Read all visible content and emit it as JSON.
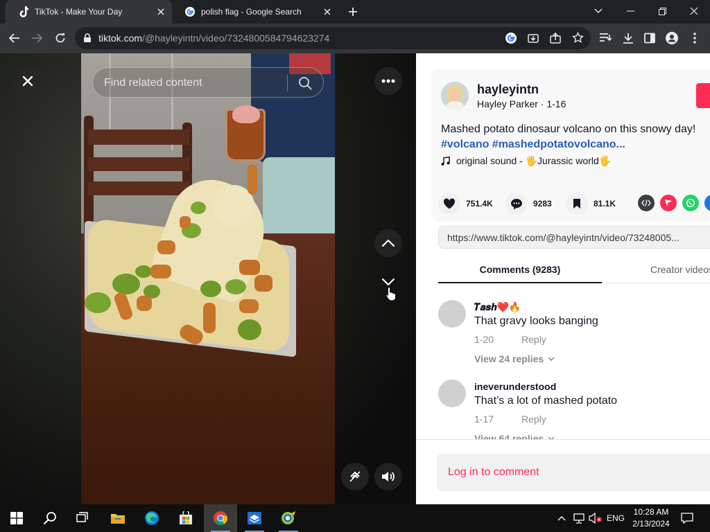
{
  "browser": {
    "tabs": [
      {
        "title": "TikTok - Make Your Day",
        "active": true,
        "favicon": "tiktok-icon"
      },
      {
        "title": "polish flag - Google Search",
        "active": false,
        "favicon": "google-icon"
      }
    ],
    "url": {
      "host": "tiktok.com",
      "path": "/@hayleyintn/video/7324800584794623274"
    }
  },
  "video": {
    "search_placeholder": "Find related content"
  },
  "post": {
    "author_id": "hayleyintn",
    "author_name": "Hayley Parker",
    "date": "1-16",
    "author_sub": "Hayley Parker · 1-16",
    "description": "Mashed potato dinosaur volcano on this snowy day!",
    "hashtags": "#volcano #mashedpotatovolcano...",
    "sound": "original sound - 🖐️Jurassic world🖐️",
    "likes": "751.4K",
    "comments_count": "9283",
    "saves": "81.1K",
    "link": "https://www.tiktok.com/@hayleyintn/video/73248005..."
  },
  "panel_tabs": {
    "comments": "Comments (9283)",
    "creator": "Creator videos"
  },
  "comments": [
    {
      "user": "𝑻𝒂𝒔𝒉❤️🔥",
      "text": "That gravy looks banging",
      "date": "1-20",
      "reply": "Reply",
      "view_replies": "View 24 replies"
    },
    {
      "user": "ineverunderstood",
      "text": "That’s a lot of mashed potato",
      "date": "1-17",
      "reply": "Reply",
      "view_replies": "View 64 replies"
    }
  ],
  "login_prompt": "Log in to comment",
  "taskbar": {
    "language": "ENG",
    "time": "10:28 AM",
    "date": "2/13/2024"
  },
  "colors": {
    "tiktok_red": "#fe2c55",
    "hashtag_blue": "#2b5db9",
    "chrome_dark": "#202124",
    "chrome_toolbar": "#35363a"
  }
}
